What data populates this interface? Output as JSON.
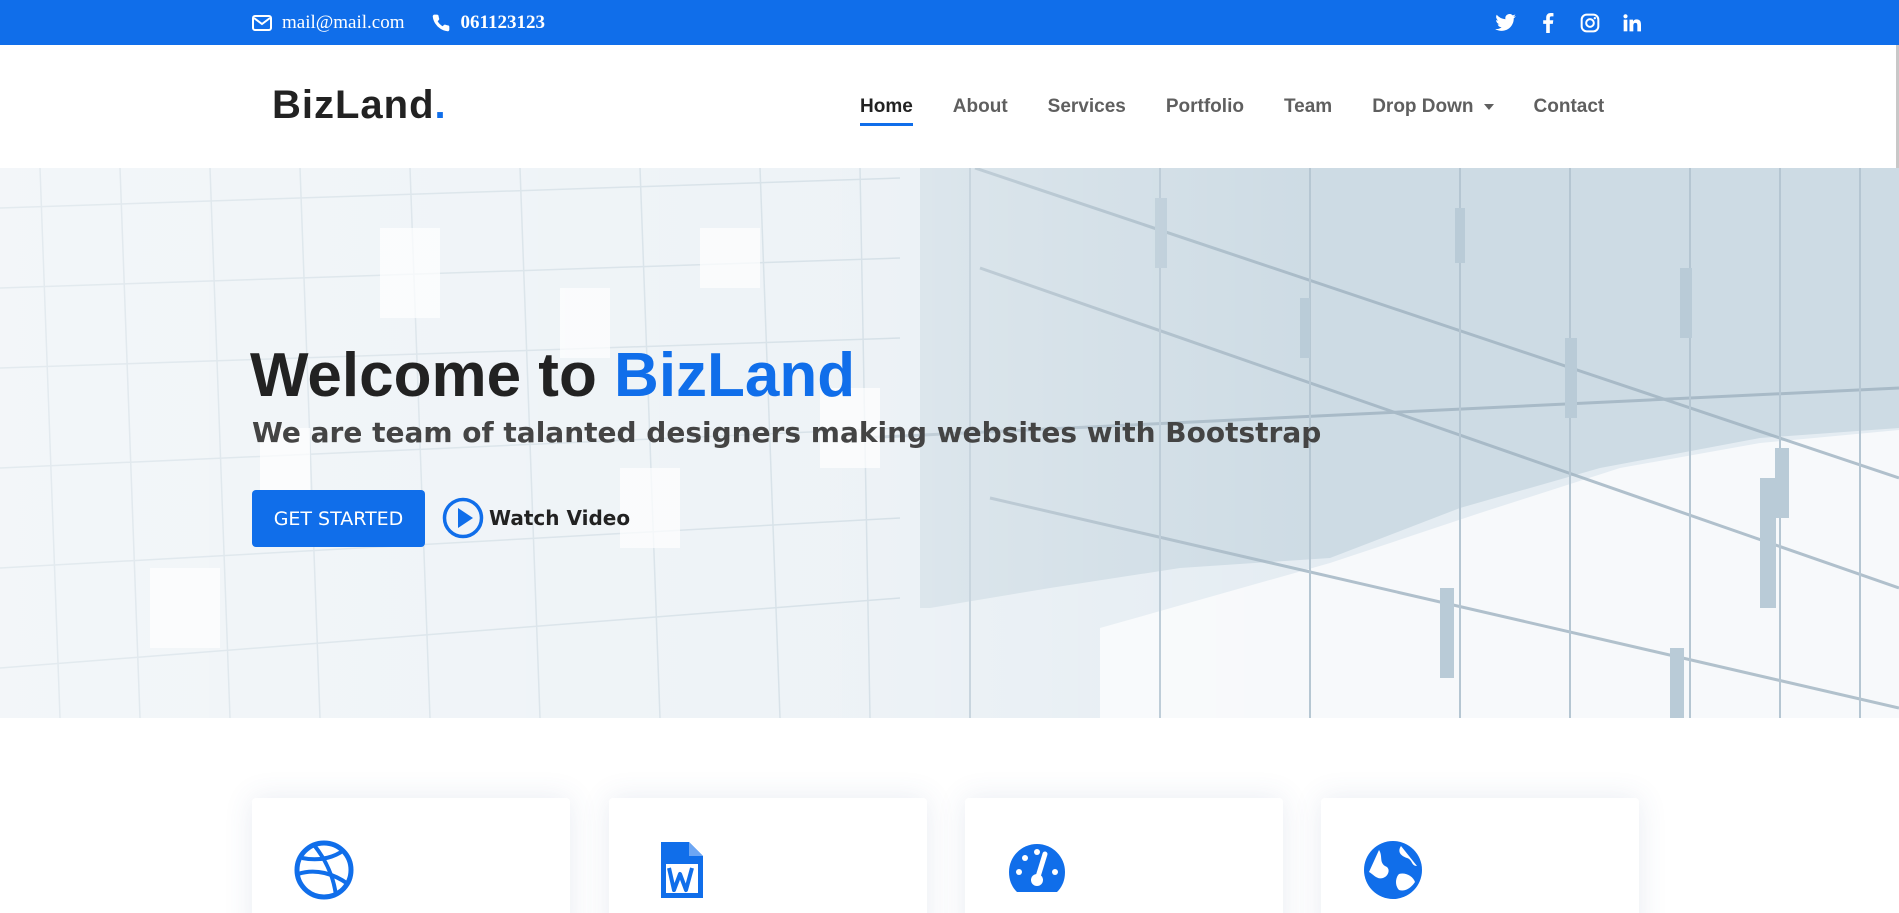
{
  "topbar": {
    "email": "mail@mail.com",
    "phone": "061123123",
    "social": [
      "twitter-icon",
      "facebook-icon",
      "instagram-icon",
      "linkedin-icon"
    ],
    "background": "#106eea"
  },
  "header": {
    "logo": "BizLand",
    "logo_dot": ".",
    "nav": [
      {
        "label": "Home",
        "active": true
      },
      {
        "label": "About"
      },
      {
        "label": "Services"
      },
      {
        "label": "Portfolio"
      },
      {
        "label": "Team"
      },
      {
        "label": "Drop Down",
        "dropdown": true
      },
      {
        "label": "Contact"
      }
    ]
  },
  "hero": {
    "title_prefix": "Welcome to ",
    "title_brand": "BizLand",
    "subtitle": "We are team of talanted designers making websites with Bootstrap",
    "cta_label": "GET STARTED",
    "video_label": "Watch Video"
  },
  "cards": [
    {
      "icon": "dribbble-icon"
    },
    {
      "icon": "word-file-icon"
    },
    {
      "icon": "speedometer-icon"
    },
    {
      "icon": "globe-icon"
    }
  ],
  "colors": {
    "accent": "#106eea",
    "heading": "#222222",
    "nav_text": "#5f5f5f"
  }
}
